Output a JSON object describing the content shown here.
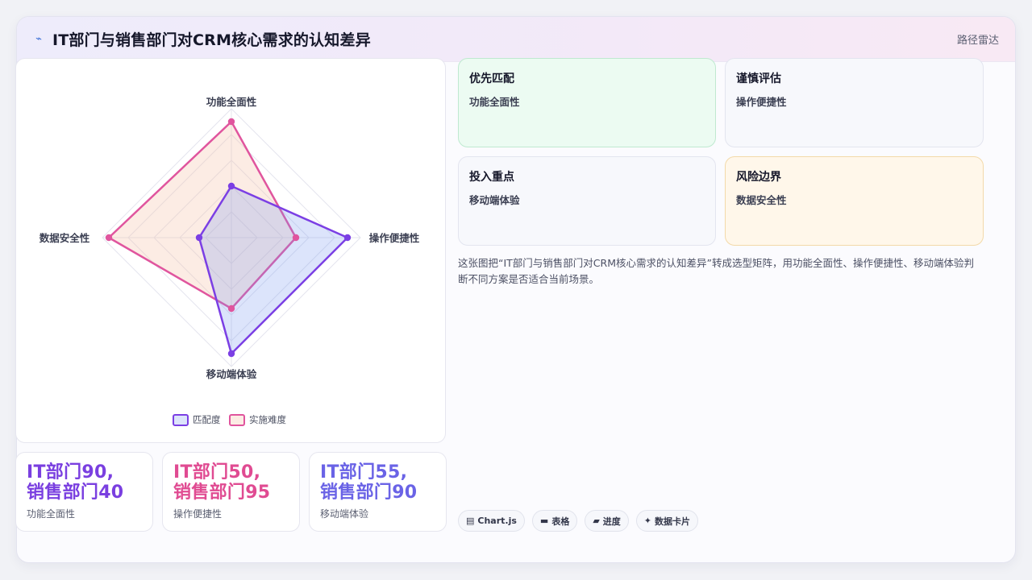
{
  "header": {
    "icon": "chart-line-icon",
    "title": "IT部门与销售部门对CRM核心需求的认知差异",
    "tag": "路径雷达"
  },
  "chart_data": {
    "type": "radar",
    "axes": [
      "功能全面性",
      "操作便捷性",
      "移动端体验",
      "数据安全性"
    ],
    "rmax": 100,
    "series": [
      {
        "name": "匹配度",
        "values": [
          40,
          90,
          90,
          25
        ],
        "color": "#7b3fe4",
        "fill": "rgba(120,150,240,0.26)"
      },
      {
        "name": "实施难度",
        "values": [
          90,
          50,
          55,
          95
        ],
        "color": "#e0559e",
        "fill": "rgba(245,195,170,0.32)"
      }
    ],
    "grid": true,
    "legend": "bottom"
  },
  "stats": [
    {
      "value": "IT部门90,\n销售部门40",
      "label": "功能全面性",
      "color": "#7a3fe0"
    },
    {
      "value": "IT部门50,\n销售部门95",
      "label": "操作便捷性",
      "color": "#e04b92"
    },
    {
      "value": "IT部门55,\n销售部门90",
      "label": "移动端体验",
      "color": "#6a63e6"
    }
  ],
  "cells": [
    {
      "title": "优先匹配",
      "sub": "功能全面性"
    },
    {
      "title": "谨慎评估",
      "sub": "操作便捷性"
    },
    {
      "title": "投入重点",
      "sub": "移动端体验"
    },
    {
      "title": "风险边界",
      "sub": "数据安全性"
    }
  ],
  "description": "这张图把“IT部门与销售部门对CRM核心需求的认知差异”转成选型矩阵，用功能全面性、操作便捷性、移动端体验判断不同方案是否适合当前场景。",
  "tags": [
    {
      "icon": "chart-icon",
      "glyph": "▤",
      "label": "Chart.js"
    },
    {
      "icon": "table-icon",
      "glyph": "▬",
      "label": "表格"
    },
    {
      "icon": "progress-icon",
      "glyph": "▰",
      "label": "进度"
    },
    {
      "icon": "sparkle-icon",
      "glyph": "✦",
      "label": "数据卡片"
    }
  ]
}
